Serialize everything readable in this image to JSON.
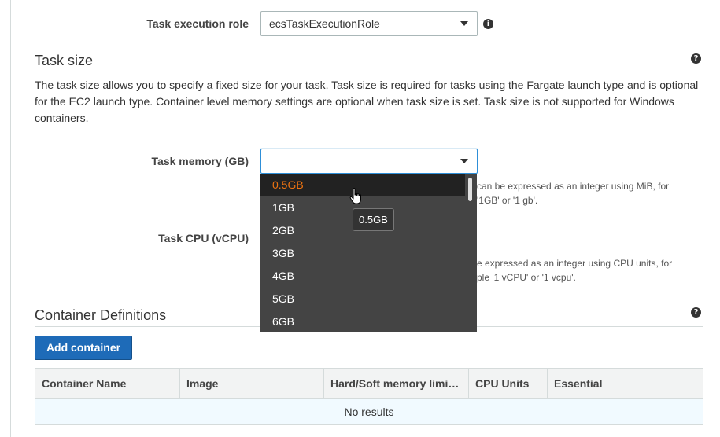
{
  "execution_role": {
    "label": "Task execution role",
    "value": "ecsTaskExecutionRole"
  },
  "task_size": {
    "title": "Task size",
    "description": "The task size allows you to specify a fixed size for your task. Task size is required for tasks using the Fargate launch type and is optional for the EC2 launch type. Container level memory settings are optional when task size is set. Task size is not supported for Windows containers.",
    "memory": {
      "label": "Task memory (GB)",
      "value": "",
      "hint_line1": "can be expressed as an integer using MiB, for",
      "hint_line2": "'1GB' or '1 gb'."
    },
    "cpu": {
      "label": "Task CPU (vCPU)",
      "hint_line1": "e expressed as an integer using CPU units, for",
      "hint_line2": "ple '1 vCPU' or '1 vcpu'."
    }
  },
  "memory_dropdown": {
    "options": [
      "0.5GB",
      "1GB",
      "2GB",
      "3GB",
      "4GB",
      "5GB",
      "6GB"
    ],
    "highlighted": "0.5GB",
    "tooltip": "0.5GB"
  },
  "container_definitions": {
    "title": "Container Definitions",
    "add_button": "Add container",
    "columns": [
      "Container Name",
      "Image",
      "Hard/Soft memory limi…",
      "CPU Units",
      "Essential",
      ""
    ],
    "empty_text": "No results"
  },
  "icons": {
    "info": "info-icon",
    "help": "help-icon",
    "caret": "chevron-down-icon",
    "cursor": "hand-pointer-icon"
  },
  "colors": {
    "primary_button": "#1e6bb8",
    "highlight_text": "#ec7211",
    "dropdown_bg": "#444444",
    "focus_border": "#2e8fd8"
  }
}
